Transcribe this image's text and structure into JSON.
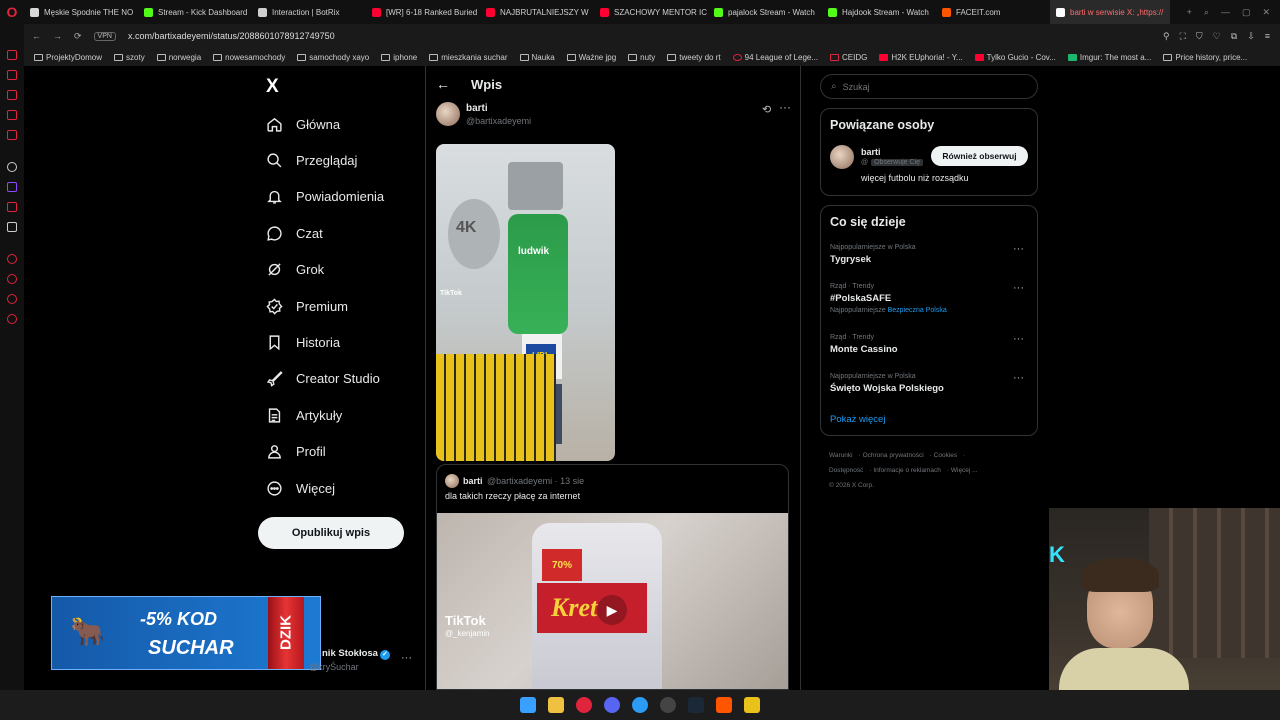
{
  "browser": {
    "tabs": [
      {
        "label": "Męskie Spodnie THE NO",
        "color": "#d9d9d9"
      },
      {
        "label": "Stream - Kick Dashboard",
        "color": "#53fc18"
      },
      {
        "label": "Interaction | BotRix",
        "color": "#cfcfcf"
      },
      {
        "label": "[WR] 6-18 Ranked Buried",
        "color": "#ff0033"
      },
      {
        "label": "NAJBRUTALNIEJSZY W",
        "color": "#ff0033"
      },
      {
        "label": "SZACHOWY MENTOR IC",
        "color": "#ff0033"
      },
      {
        "label": "pajalock Stream - Watch",
        "color": "#53fc18"
      },
      {
        "label": "Hajdook Stream - Watch",
        "color": "#53fc18"
      },
      {
        "label": "FACEIT.com",
        "color": "#ff5500"
      },
      {
        "label": "barti w serwisie X: „https://",
        "color": "#ffffff"
      }
    ],
    "vpn_label": "VPN",
    "url": "x.com/bartixadeyemi/status/2088601078912749750",
    "bookmarks": [
      "ProjektyDomow",
      "szoty",
      "norwegia",
      "nowesamochody",
      "samochody xayo",
      "iphone",
      "mieszkania suchar",
      "Nauka",
      "Ważne jpg",
      "nuty",
      "tweety do rt",
      "94 League of Lege...",
      "CEIDG",
      "H2K EUphoria! - Y...",
      "Tylko Gucio - Cov...",
      "Imgur: The most a...",
      "Price history, price..."
    ]
  },
  "nav": {
    "logo": "X",
    "items": [
      {
        "label": "Główna",
        "icon": "home-icon"
      },
      {
        "label": "Przeglądaj",
        "icon": "search-icon"
      },
      {
        "label": "Powiadomienia",
        "icon": "bell-icon"
      },
      {
        "label": "Czat",
        "icon": "chat-icon"
      },
      {
        "label": "Grok",
        "icon": "grok-icon"
      },
      {
        "label": "Premium",
        "icon": "premium-icon"
      },
      {
        "label": "Historia",
        "icon": "bookmark-icon"
      },
      {
        "label": "Creator Studio",
        "icon": "rocket-icon"
      },
      {
        "label": "Artykuły",
        "icon": "article-icon"
      },
      {
        "label": "Profil",
        "icon": "person-icon"
      },
      {
        "label": "Więcej",
        "icon": "more-circle-icon"
      }
    ],
    "post_button": "Opublikuj wpis"
  },
  "post": {
    "header_title": "Wpis",
    "author_name": "barti",
    "author_handle": "@bartixadeyemi",
    "media_dish_text": "4K",
    "media_bottle_text": "ludwik",
    "media_bag_text": "LIDL",
    "media_watermark": "TikTok",
    "quote": {
      "name": "barti",
      "handle_time": "@bartixadeyemi · 13 sie",
      "text": "dla takich rzeczy płacę za internet",
      "media_product_text": "Kret",
      "media_percent_text": "70%",
      "media_watermark": "TikTok",
      "media_watermark_handle": "@_kenjamin"
    }
  },
  "right": {
    "search_placeholder": "Szukaj",
    "related": {
      "title": "Powiązane osoby",
      "name": "barti",
      "badge": "Obserwuje Cię",
      "follow_button": "Również obserwuj",
      "bio": "więcej futbolu niż rozsądku"
    },
    "trends": {
      "title": "Co się dzieje",
      "items": [
        {
          "context": "Najpopularniejsze w Polska",
          "name": "Tygrysek",
          "sub": "",
          "sub_link": ""
        },
        {
          "context": "Rząd · Trendy",
          "name": "#PolskaSAFE",
          "sub": "Najpopularniejsze",
          "sub_link": "Bezpieczna Polska"
        },
        {
          "context": "Rząd · Trendy",
          "name": "Monte Cassino",
          "sub": "",
          "sub_link": ""
        },
        {
          "context": "Najpopularniejsze w Polska",
          "name": "Święto Wojska Polskiego",
          "sub": "",
          "sub_link": ""
        }
      ],
      "show_more": "Pokaż więcej"
    },
    "footer": [
      "Warunki",
      "Ochrona prywatności",
      "Cookies",
      "Dostępność",
      "Informacje o reklamach",
      "Więcej ...",
      "© 2026 X Corp."
    ]
  },
  "overlay": {
    "ad_top": "-5% KOD",
    "ad_code": "SUCHAR",
    "ad_can_text": "DZIK",
    "account_name": "nik Stokłosa",
    "account_handle": "@kryŚuchar",
    "webcam_neon": "K"
  },
  "colors": {
    "accent": "#1d9bf0",
    "background": "#000000",
    "border": "#2f3336",
    "muted": "#71767b"
  }
}
